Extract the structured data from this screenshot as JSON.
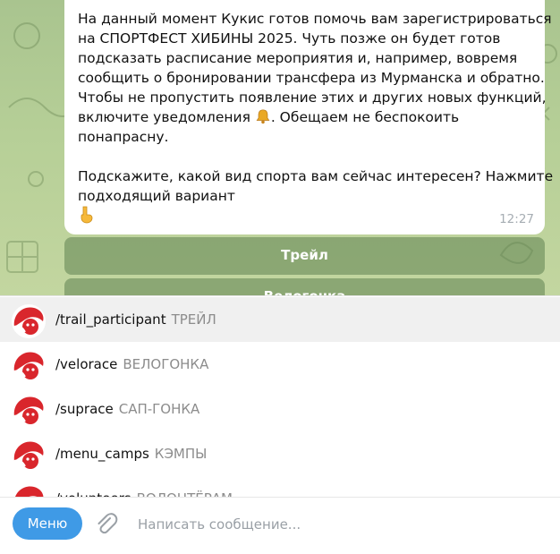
{
  "message": {
    "lines": [
      "На данный момент Кукис готов помочь вам зарегистрироваться",
      "на СПОРТФЕСТ ХИБИНЫ 2025. Чуть позже он будет готов",
      "подсказать расписание мероприятия и, например, вовремя",
      "сообщить о бронировании трансфера из Мурманска и обратно.",
      "Чтобы не пропустить появление этих и других новых функций,",
      "включите уведомления",
      ". Обещаем не беспокоить",
      "понапрасну.",
      "Подскажите, какой вид спорта вам сейчас интересен? Нажмите",
      "подходящий вариант"
    ],
    "time": "12:27"
  },
  "keyboard": {
    "buttons": [
      "Трейл",
      "Велогонка"
    ]
  },
  "commands": [
    {
      "name": "/trail_participant",
      "desc": "ТРЕЙЛ"
    },
    {
      "name": "/velorace",
      "desc": "ВЕЛОГОНКА"
    },
    {
      "name": "/suprace",
      "desc": "САП-ГОНКА"
    },
    {
      "name": "/menu_camps",
      "desc": "КЭМПЫ"
    },
    {
      "name": "/volunteers",
      "desc": "ВОЛОНТЁРАМ"
    }
  ],
  "composer": {
    "menu_label": "Меню",
    "placeholder": "Написать сообщение..."
  },
  "colors": {
    "accent": "#3f9ae6",
    "chat_bg": "#b6cf97",
    "avatar_red": "#d9262c"
  }
}
